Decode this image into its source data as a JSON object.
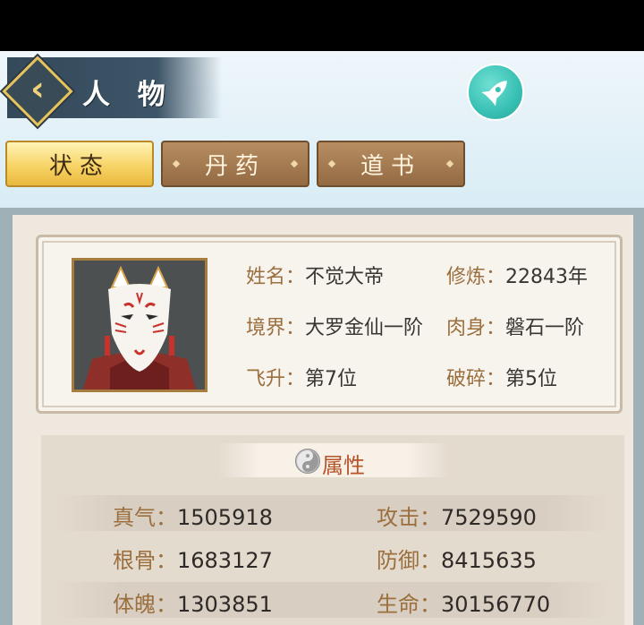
{
  "header": {
    "title": "人 物"
  },
  "tabs": [
    {
      "label": "状态",
      "active": true
    },
    {
      "label": "丹药",
      "active": false
    },
    {
      "label": "道书",
      "active": false
    }
  ],
  "profile": {
    "name_label": "姓名：",
    "name_value": "不觉大帝",
    "cultivation_label": "修炼：",
    "cultivation_value": "22843年",
    "realm_label": "境界：",
    "realm_value": "大罗金仙一阶",
    "body_label": "肉身：",
    "body_value": "磐石一阶",
    "ascend_label": "飞升：",
    "ascend_value": "第7位",
    "shatter_label": "破碎：",
    "shatter_value": "第5位"
  },
  "attributes": {
    "title": "属性",
    "rows": [
      {
        "left_label": "真气：",
        "left_value": "1505918",
        "right_label": "攻击：",
        "right_value": "7529590"
      },
      {
        "left_label": "根骨：",
        "left_value": "1683127",
        "right_label": "防御：",
        "right_value": "8415635"
      },
      {
        "left_label": "体魄：",
        "left_value": "1303851",
        "right_label": "生命：",
        "right_value": "30156770"
      }
    ]
  },
  "icons": {
    "back": "chevron-left-icon",
    "rocket": "rocket-icon",
    "yin_yang": "yin-yang-icon",
    "avatar": "fox-mask-avatar"
  },
  "colors": {
    "tab_active": "#f7d466",
    "tab_inactive": "#946a43",
    "label_brown": "#9b6f3e",
    "attr_title": "#b8542a",
    "rocket_teal": "#38c0b4"
  }
}
